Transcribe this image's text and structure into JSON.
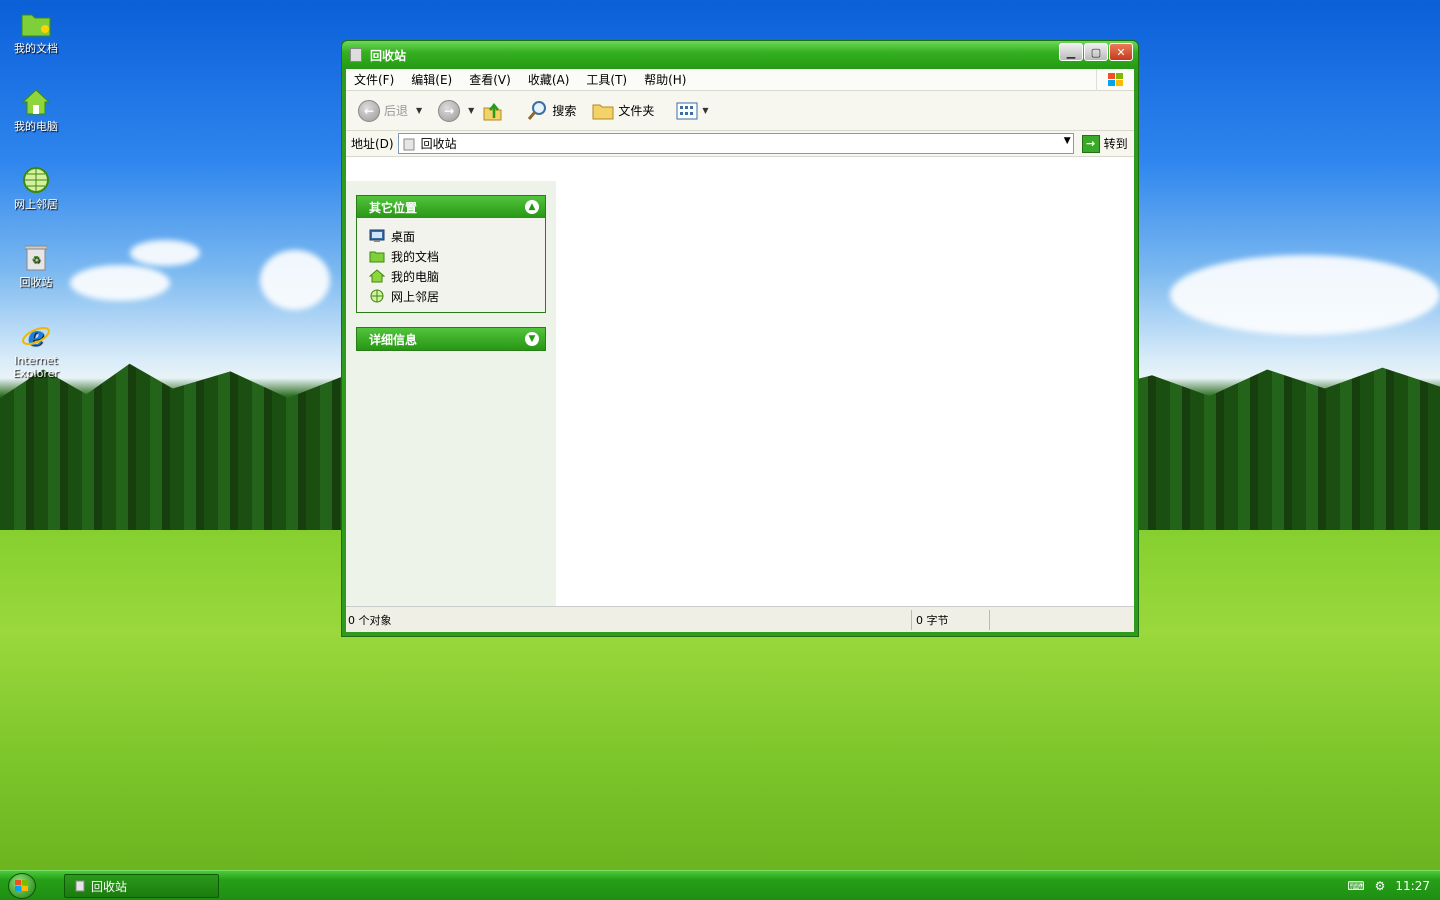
{
  "desktop": {
    "icons": [
      {
        "label": "我的文档",
        "icon": "folder-icon"
      },
      {
        "label": "我的电脑",
        "icon": "home-icon"
      },
      {
        "label": "网上邻居",
        "icon": "globe-icon"
      },
      {
        "label": "回收站",
        "icon": "recycle-bin-icon"
      },
      {
        "label": "Internet Explorer",
        "icon": "ie-icon"
      }
    ]
  },
  "window": {
    "title": "回收站",
    "menu": [
      "文件(F)",
      "编辑(E)",
      "查看(V)",
      "收藏(A)",
      "工具(T)",
      "帮助(H)"
    ],
    "toolbar": {
      "back": "后退",
      "search": "搜索",
      "folders": "文件夹"
    },
    "address": {
      "label": "地址(D)",
      "value": "回收站",
      "go": "转到"
    },
    "taskpane": {
      "other_places": {
        "title": "其它位置",
        "items": [
          "桌面",
          "我的文档",
          "我的电脑",
          "网上邻居"
        ]
      },
      "details": {
        "title": "详细信息"
      }
    },
    "status": {
      "objects": "0 个对象",
      "size": "0 字节"
    }
  },
  "taskbar": {
    "task_label": "回收站",
    "clock": "11:27"
  }
}
